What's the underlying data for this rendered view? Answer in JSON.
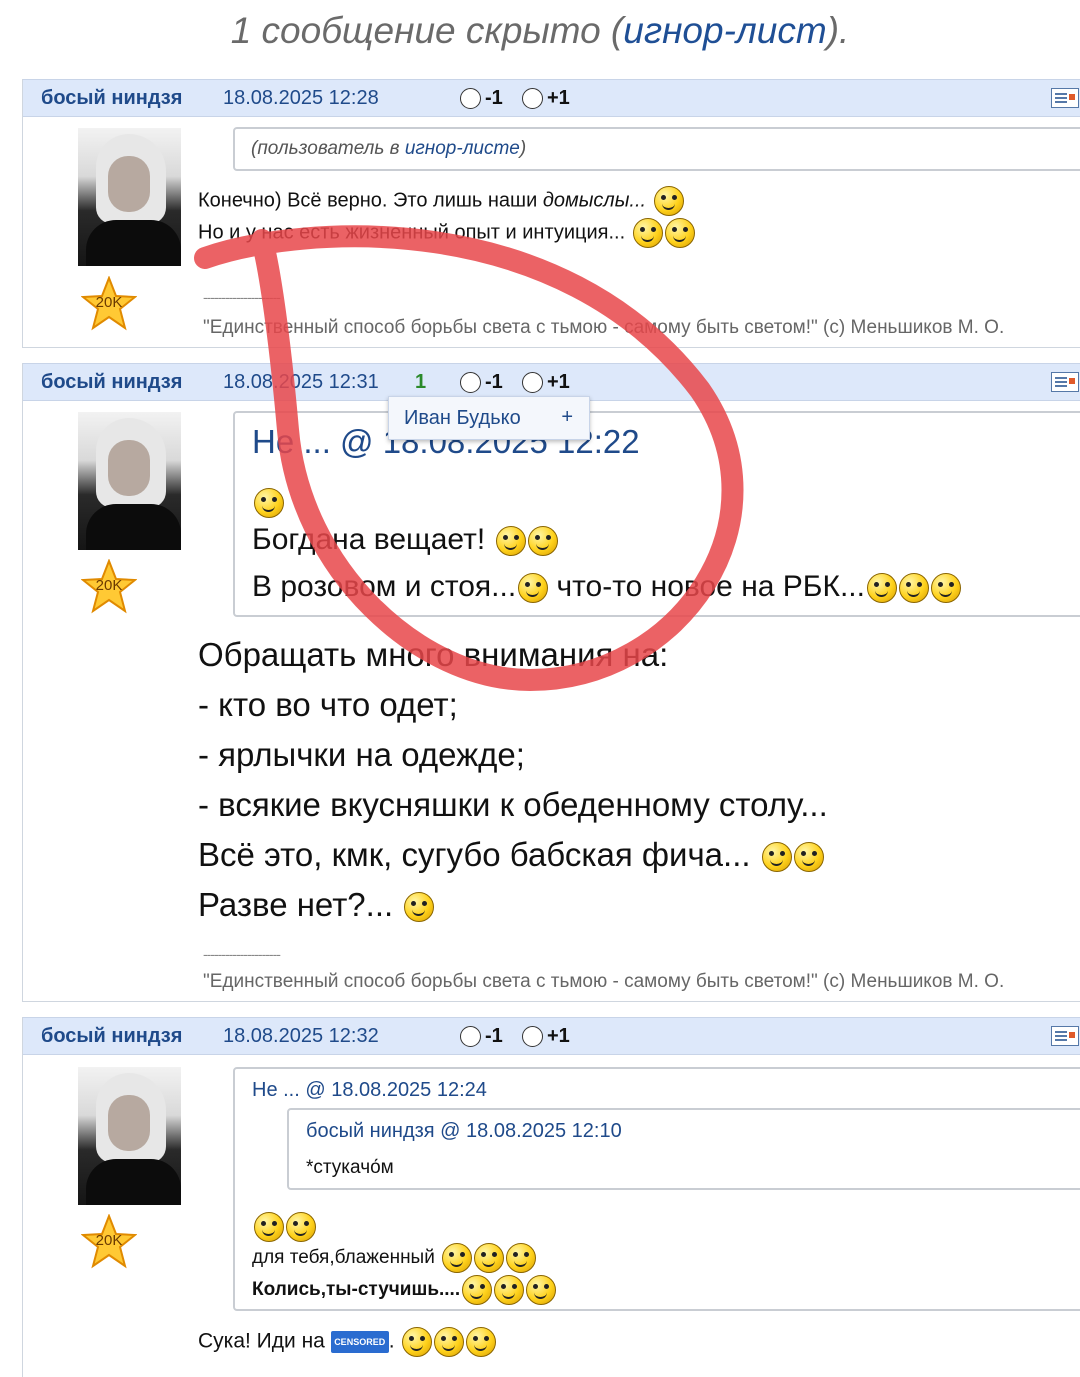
{
  "hidden_notice": {
    "prefix": "1 сообщение скрыто (",
    "link": "игнор-лист",
    "suffix": ")."
  },
  "posts": [
    {
      "author": "босый ниндзя",
      "date": "18.08.2025 12:28",
      "vote_minus": "-1",
      "vote_plus": "+1",
      "badge": "20K",
      "quote_text_1": "(пользователь в ",
      "quote_link": "игнор-листе",
      "quote_text_2": ")",
      "line1_a": "Конечно) Всё верно. Это лишь наши ",
      "line1_b": "домыслы...",
      "line2": "Но и у нас есть жизненный опыт и интуиция...",
      "sig_line": "---------------------",
      "signature": "\"Единственный способ борьбы света с тьмою - самому быть светом!\" (с) Меньшиков М. О."
    },
    {
      "author": "босый ниндзя",
      "date": "18.08.2025 12:31",
      "vote_count": "1",
      "vote_minus": "-1",
      "vote_plus": "+1",
      "badge": "20K",
      "quote_head": "Не ... @ 18.08.2025 12:22",
      "quote_line1": "Богдана вещает!",
      "quote_line2a": "В розовом и стоя...",
      "quote_line2b": "что-то новое на РБК...",
      "lines": [
        "Обращать много внимания на:",
        "- кто во что одет;",
        "- ярлычки на одежде;",
        "- всякие вкусняшки к обеденному столу...",
        "Всё это, кмк, сугубо бабская фича...",
        "Разве нет?..."
      ],
      "sig_line": "---------------------",
      "signature": "\"Единственный способ борьбы света с тьмою - самому быть светом!\" (с) Меньшиков М. О."
    },
    {
      "author": "босый ниндзя",
      "date": "18.08.2025 12:32",
      "vote_minus": "-1",
      "vote_plus": "+1",
      "badge": "20K",
      "quote_head": "Не ... @ 18.08.2025 12:24",
      "inner_quote_head": "босый ниндзя @ 18.08.2025 12:10",
      "inner_quote_text": "*стукачо́м",
      "quote_line1": "для тебя,блаженный",
      "quote_line2": "Колись,ты-стучишь....",
      "body_a": "Сука! Иди на",
      "censored": "CENSORED",
      "body_b": "."
    }
  ],
  "popup": {
    "name": "Иван Будько",
    "plus": "+"
  },
  "colors": {
    "header_bg": "#dde8fa",
    "link": "#1f4a8a",
    "annotation": "#e8474a",
    "vote_count": "#2b8a2b"
  }
}
